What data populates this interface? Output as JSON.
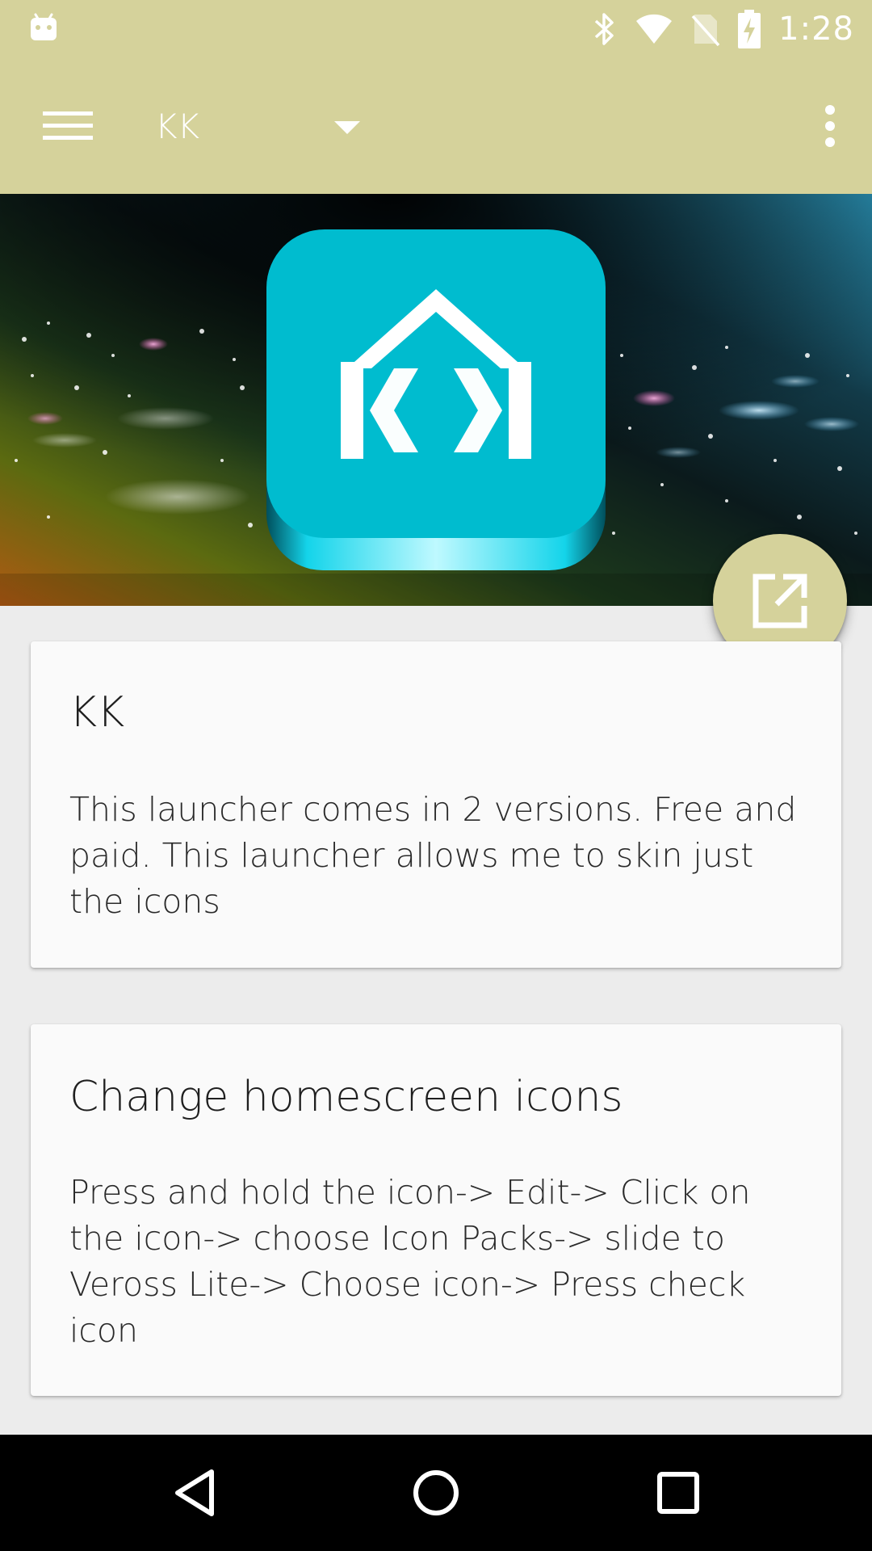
{
  "status_bar": {
    "time": "1:28",
    "icons": [
      "android-icon",
      "bluetooth-icon",
      "wifi-icon",
      "no-sim-icon",
      "battery-charging-icon"
    ]
  },
  "toolbar": {
    "title": "KK",
    "icons": [
      "menu-icon",
      "dropdown-arrow-icon",
      "overflow-menu-icon"
    ]
  },
  "banner": {
    "app_icon": "kk-launcher-icon",
    "logo_text": "KK"
  },
  "fab": {
    "icon": "open-external-icon"
  },
  "cards": [
    {
      "title": "KK",
      "body": "This launcher comes in 2 versions. Free and paid. This launcher allows me to skin just the icons"
    },
    {
      "title": "Change homescreen icons",
      "body": "Press and hold the icon-> Edit-> Click on the icon-> choose Icon Packs-> slide to Veross Lite-> Choose icon-> Press check icon"
    }
  ],
  "nav_bar": {
    "icons": [
      "back-icon",
      "home-icon",
      "recent-apps-icon"
    ]
  },
  "colors": {
    "accent": "#d5d29b",
    "app_icon": "#00bcd0",
    "card": "#fafafa",
    "background": "#ececec",
    "nav_bar": "#000000"
  }
}
